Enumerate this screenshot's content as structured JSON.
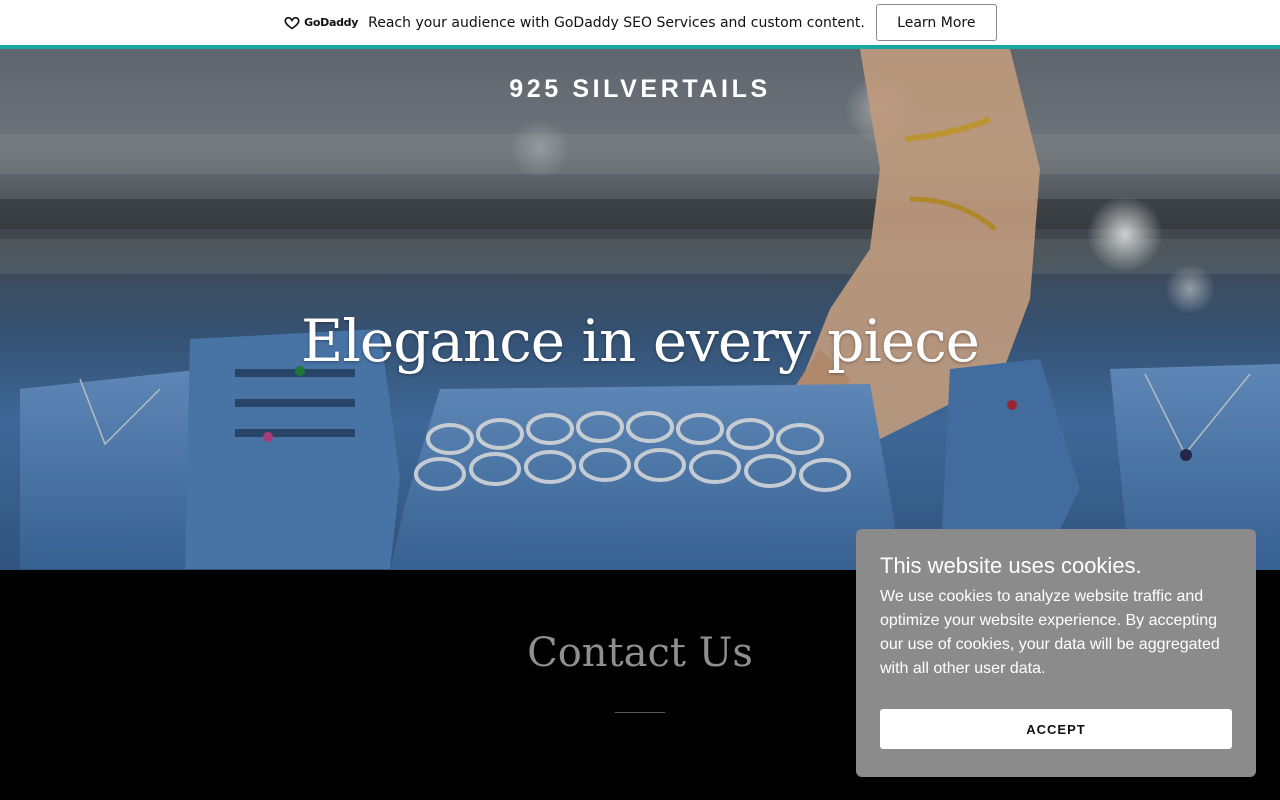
{
  "promo": {
    "logo_text": "GoDaddy",
    "message": "Reach your audience with GoDaddy SEO Services and custom content.",
    "button_label": "Learn More",
    "accent_color": "#1ba6a0"
  },
  "hero": {
    "brand": "925 SILVERTAILS",
    "headline": "Elegance in every piece"
  },
  "contact": {
    "title": "Contact Us"
  },
  "cookie_banner": {
    "title": "This website uses cookies.",
    "body": "We use cookies to analyze website traffic and optimize your website experience. By accepting our use of cookies, your data will be aggregated with all other user data.",
    "accept_label": "ACCEPT"
  }
}
